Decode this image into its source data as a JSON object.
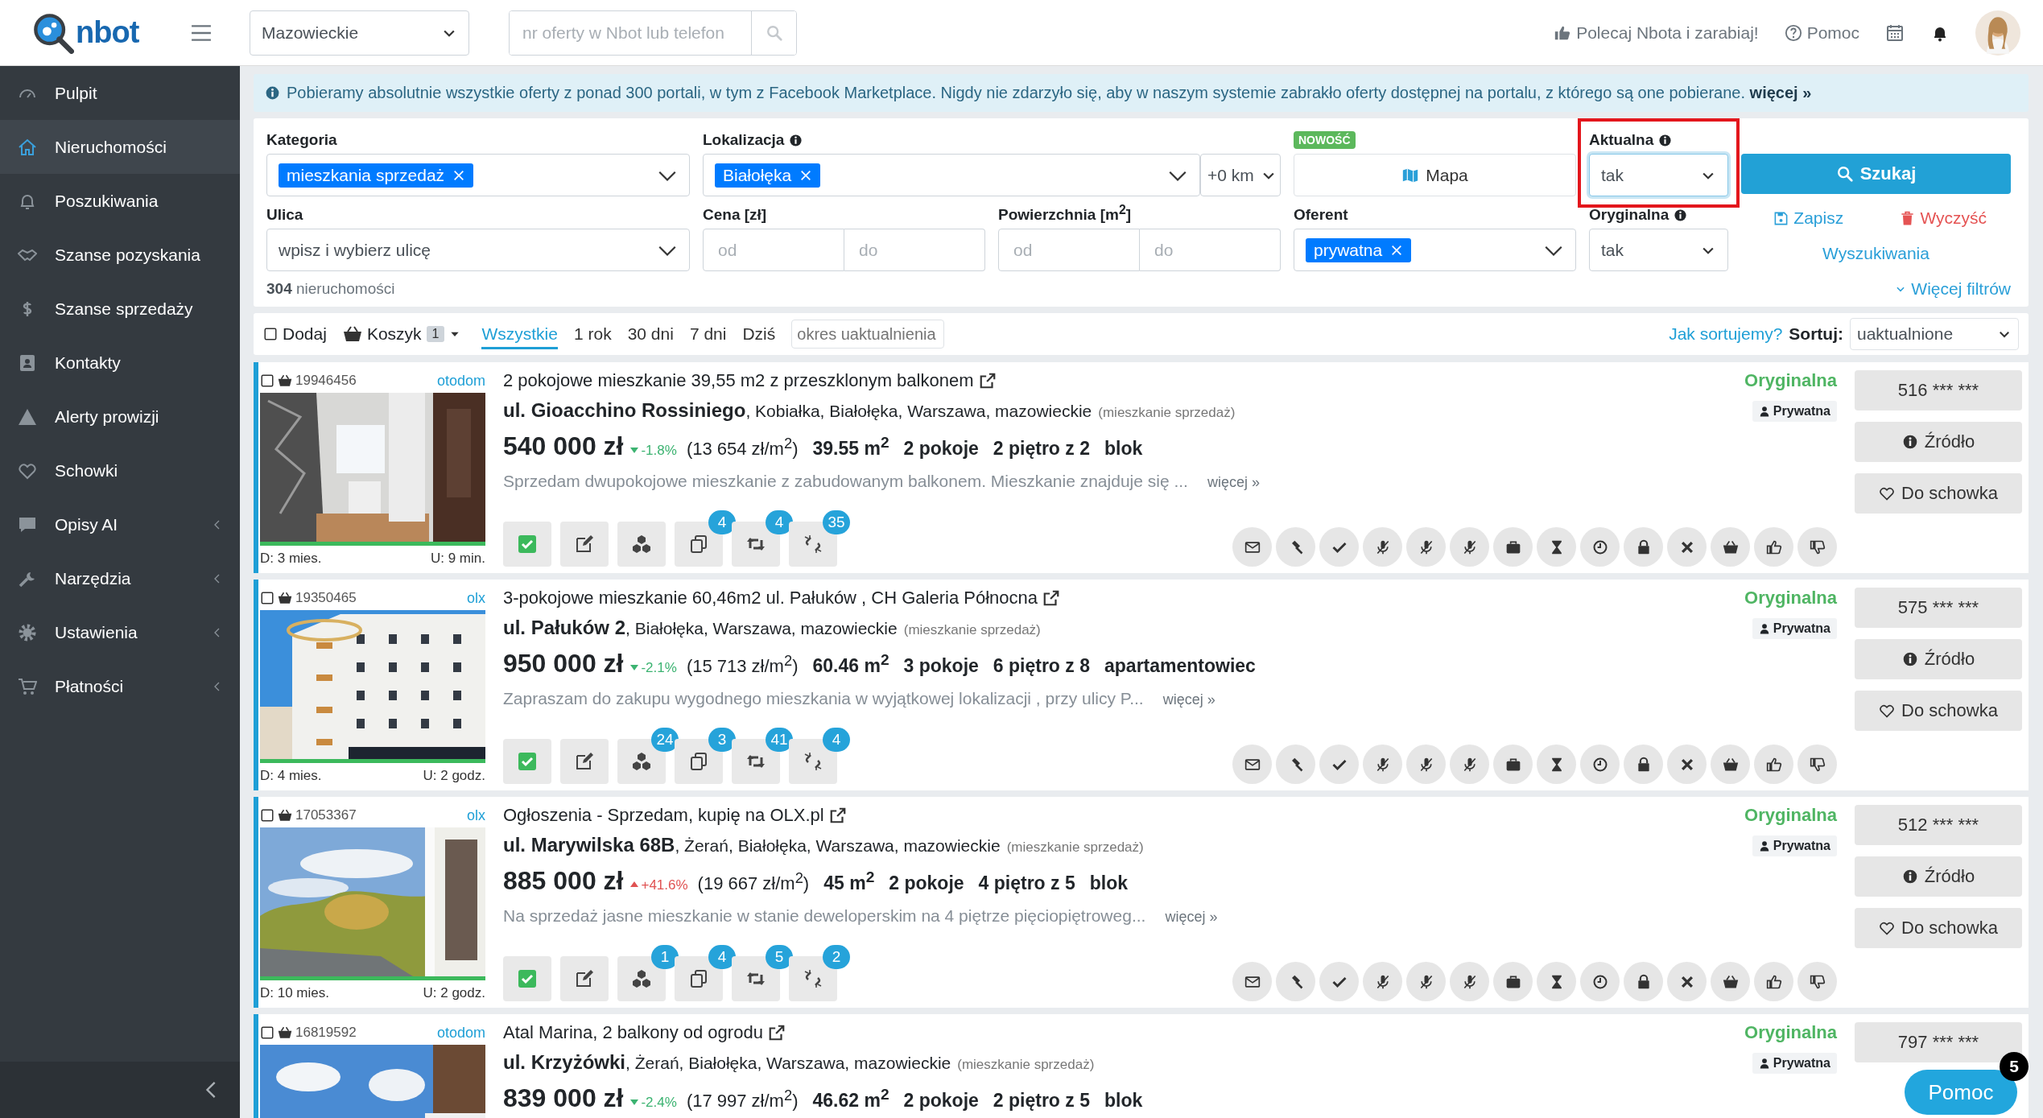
{
  "topbar": {
    "logo": "nbot",
    "region": "Mazowieckie",
    "search_placeholder": "nr oferty w Nbot lub telefon",
    "referral": "Polecaj Nbota i zarabiaj!",
    "help": "Pomoc"
  },
  "sidebar": {
    "items": [
      {
        "label": "Pulpit",
        "selected": false,
        "submenu": false
      },
      {
        "label": "Nieruchomości",
        "selected": true,
        "submenu": false
      },
      {
        "label": "Poszukiwania",
        "selected": false,
        "submenu": false
      },
      {
        "label": "Szanse pozyskania",
        "selected": false,
        "submenu": false
      },
      {
        "label": "Szanse sprzedaży",
        "selected": false,
        "submenu": false
      },
      {
        "label": "Kontakty",
        "selected": false,
        "submenu": false
      },
      {
        "label": "Alerty prowizji",
        "selected": false,
        "submenu": false
      },
      {
        "label": "Schowki",
        "selected": false,
        "submenu": false
      },
      {
        "label": "Opisy AI",
        "selected": false,
        "submenu": true
      },
      {
        "label": "Narzędzia",
        "selected": false,
        "submenu": true
      },
      {
        "label": "Ustawienia",
        "selected": false,
        "submenu": true
      },
      {
        "label": "Płatności",
        "selected": false,
        "submenu": true
      }
    ]
  },
  "info_bar": {
    "text": "Pobieramy absolutnie wszystkie oferty z ponad 300 portali, w tym z Facebook Marketplace. Nigdy nie zdarzyło się, aby w naszym systemie zabrakło oferty dostępnej na portalu, z którego są one pobierane.",
    "link": "więcej »"
  },
  "filters": {
    "category": {
      "label": "Kategoria",
      "tags": [
        "mieszkania sprzedaż"
      ]
    },
    "location": {
      "label": "Lokalizacja",
      "tags": [
        "Białołęka"
      ],
      "radius": "+0 km"
    },
    "map": {
      "badge": "NOWOŚĆ",
      "label": "Mapa"
    },
    "current": {
      "label": "Aktualna",
      "value": "tak",
      "highlighted": true
    },
    "search_button": "Szukaj",
    "street": {
      "label": "Ulica",
      "placeholder": "wpisz i wybierz ulicę"
    },
    "price": {
      "label": "Cena [zł]",
      "from_placeholder": "od",
      "to_placeholder": "do"
    },
    "area": {
      "label": "Powierzchnia [m$^{2}$]",
      "from_placeholder": "od",
      "to_placeholder": "do"
    },
    "offerer": {
      "label": "Oferent",
      "tags": [
        "prywatna"
      ]
    },
    "original": {
      "label": "Oryginalna",
      "value": "tak"
    },
    "save": "Zapisz",
    "clear": "Wyczyść",
    "searches": "Wyszukiwania",
    "more_filters": "Więcej filtrów",
    "count": "**304** nieruchomości"
  },
  "toolbar": {
    "add": {
      "label": "Dodaj",
      "checked": false
    },
    "basket": {
      "label": "Koszyk",
      "count": "1"
    },
    "periods": [
      {
        "label": "Wszystkie",
        "selected": true
      },
      {
        "label": "1 rok",
        "selected": false
      },
      {
        "label": "30 dni",
        "selected": false
      },
      {
        "label": "7 dni",
        "selected": false
      },
      {
        "label": "Dziś",
        "selected": false
      }
    ],
    "period_placeholder": "okres uaktualnienia",
    "sort_help": "Jak sortujemy?",
    "sort_label": "Sortuj:",
    "sort_value": "uaktualnione"
  },
  "listings": [
    {
      "id": "19946456",
      "portal": "otodom",
      "selected": false,
      "added": "D: 3 mies.",
      "updated": "U: 9 min.",
      "title": "2 pokojowe mieszkanie 39,55 m2 z przeszklonym balkonem",
      "street": "ul. Gioacchino Rossiniego",
      "locality": ", Kobiałka, Białołęka, Warszawa, mazowieckie",
      "category": "(mieszkanie sprzedaż)",
      "price": "540 000 zł",
      "price_up": false,
      "change": "-1.8%",
      "price_per_m2": "(13 654 zł/m$^{2}$)",
      "features": [
        "39.55 m$^{2}$",
        "2 pokoje",
        "2 piętro z 2",
        "blok"
      ],
      "description": "Sprzedam dwupokojowe mieszkanie z zabudowanym balkonem. Mieszkanie znajduje się ...",
      "more": "więcej »",
      "verified": true,
      "tool_counts": {
        "copy": "4",
        "repost": "4",
        "link": "35"
      },
      "status": "Oryginalna",
      "owner": "Prywatna",
      "phone": "516 *** ***",
      "source": "Źródło",
      "save": "Do schowka"
    },
    {
      "id": "19350465",
      "portal": "olx",
      "selected": false,
      "added": "D: 4 mies.",
      "updated": "U: 2 godz.",
      "title": "3-pokojowe mieszkanie 60,46m2 ul. Pałuków , CH Galeria Północna",
      "street": "ul. Pałuków 2",
      "locality": ", Białołęka, Warszawa, mazowieckie",
      "category": "(mieszkanie sprzedaż)",
      "price": "950 000 zł",
      "price_up": false,
      "change": "-2.1%",
      "price_per_m2": "(15 713 zł/m$^{2}$)",
      "features": [
        "60.46 m$^{2}$",
        "3 pokoje",
        "6 piętro z 8",
        "apartamentowiec"
      ],
      "description": "Zapraszam do zakupu wygodnego mieszkania w wyjątkowej lokalizacji , przy ulicy P...",
      "more": "więcej »",
      "verified": true,
      "tool_counts": {
        "cubes": "24",
        "copy": "3",
        "repost": "41",
        "link": "4"
      },
      "status": "Oryginalna",
      "owner": "Prywatna",
      "phone": "575 *** ***",
      "source": "Źródło",
      "save": "Do schowka"
    },
    {
      "id": "17053367",
      "portal": "olx",
      "selected": false,
      "added": "D: 10 mies.",
      "updated": "U: 2 godz.",
      "title": "Ogłoszenia - Sprzedam, kupię na OLX.pl",
      "street": "ul. Marywilska 68B",
      "locality": ", Żerań, Białołęka, Warszawa, mazowieckie",
      "category": "(mieszkanie sprzedaż)",
      "price": "885 000 zł",
      "price_up": true,
      "change": "+41.6%",
      "price_per_m2": "(19 667 zł/m$^{2}$)",
      "features": [
        "45 m$^{2}$",
        "2 pokoje",
        "4 piętro z 5",
        "blok"
      ],
      "description": "Na sprzedaż jasne mieszkanie w stanie deweloperskim na 4 piętrze pięciopiętroweg...",
      "more": "więcej »",
      "verified": true,
      "tool_counts": {
        "cubes": "1",
        "copy": "4",
        "repost": "5",
        "link": "2"
      },
      "status": "Oryginalna",
      "owner": "Prywatna",
      "phone": "512 *** ***",
      "source": "Źródło",
      "save": "Do schowka"
    },
    {
      "id": "16819592",
      "portal": "otodom",
      "selected": false,
      "title": "Atal Marina, 2 balkony od ogrodu",
      "street": "ul. Krzyżówki",
      "locality": ", Żerań, Białołęka, Warszawa, mazowieckie",
      "category": "(mieszkanie sprzedaż)",
      "price": "839 000 zł",
      "price_up": false,
      "change": "-2.4%",
      "price_per_m2": "(17 997 zł/m$^{2}$)",
      "features": [
        "46.62 m$^{2}$",
        "2 pokoje",
        "2 piętro z 5",
        "blok"
      ],
      "status": "Oryginalna",
      "owner": "Prywatna",
      "phone": "797 *** ***"
    }
  ],
  "help_button": {
    "label": "Pomoc",
    "badge": "5"
  }
}
